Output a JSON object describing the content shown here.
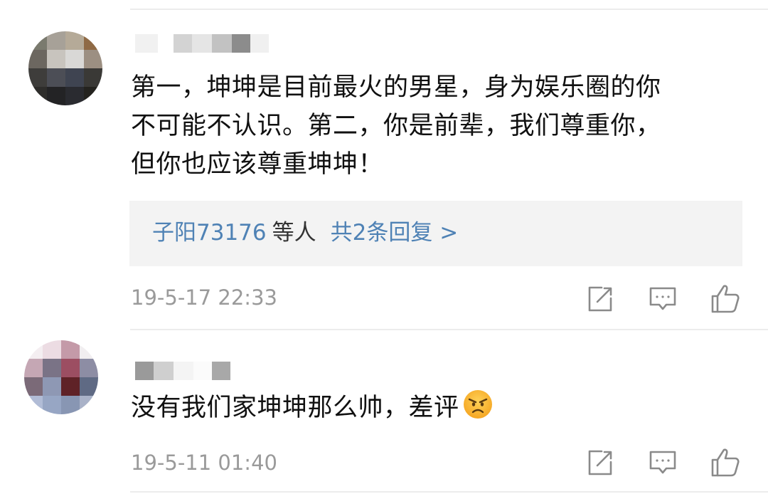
{
  "comments": [
    {
      "text_lines": [
        "第一，坤坤是目前最火的男星，身为娱乐圈的你",
        "不可能不认识。第二，你是前辈，我们尊重你，",
        "但你也应该尊重坤坤！"
      ],
      "replies": {
        "users_label": "子阳73176",
        "suffix_label": "等人",
        "count_label": "共2条回复 >"
      },
      "timestamp": "19-5-17 22:33",
      "actions": [
        "share-icon",
        "comment-icon",
        "like-icon"
      ]
    },
    {
      "text": "没有我们家坤坤那么帅，差评",
      "emoji": "angry-face-emoji",
      "timestamp": "19-5-11 01:40",
      "actions": [
        "share-icon",
        "comment-icon",
        "like-icon"
      ]
    }
  ],
  "colors": {
    "link": "#4f82b5",
    "text": "#111111",
    "meta": "#9a9a9a",
    "icon": "#8a8a8a",
    "reply_bg": "#f3f3f3"
  }
}
